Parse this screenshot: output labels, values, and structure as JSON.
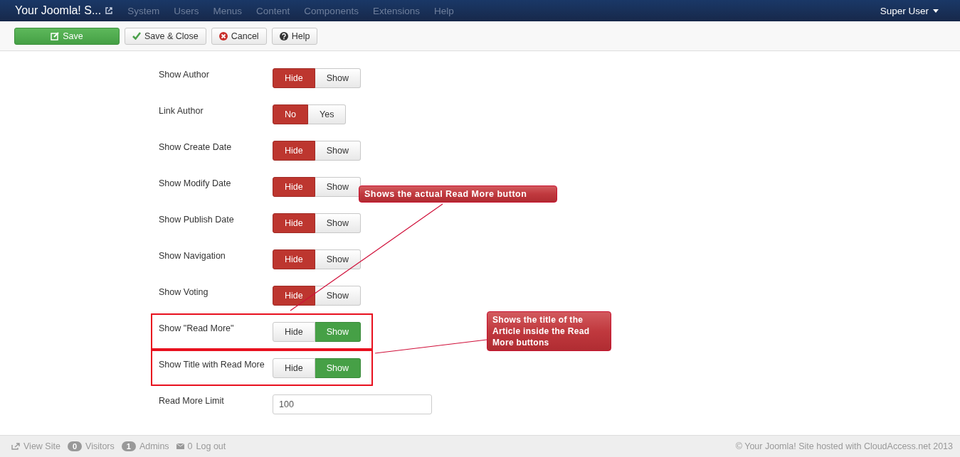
{
  "navbar": {
    "site_title": "Your Joomla! S...",
    "menu": [
      "System",
      "Users",
      "Menus",
      "Content",
      "Components",
      "Extensions",
      "Help"
    ],
    "user": "Super User"
  },
  "toolbar": [
    {
      "label": "Save",
      "kind": "primary"
    },
    {
      "label": "Save & Close",
      "kind": "check"
    },
    {
      "label": "Cancel",
      "kind": "cancel"
    },
    {
      "label": "Help",
      "kind": "help"
    }
  ],
  "fields": [
    {
      "label": "Show Author",
      "kind": "toggle",
      "highlighted": false,
      "options": [
        {
          "label": "Hide",
          "selected": true
        },
        {
          "label": "Show",
          "selected": false
        }
      ]
    },
    {
      "label": "Link Author",
      "kind": "toggle",
      "highlighted": false,
      "options": [
        {
          "label": "No",
          "selected": true
        },
        {
          "label": "Yes",
          "selected": false
        }
      ]
    },
    {
      "label": "Show Create Date",
      "kind": "toggle",
      "highlighted": false,
      "options": [
        {
          "label": "Hide",
          "selected": true
        },
        {
          "label": "Show",
          "selected": false
        }
      ]
    },
    {
      "label": "Show Modify Date",
      "kind": "toggle",
      "highlighted": false,
      "options": [
        {
          "label": "Hide",
          "selected": true
        },
        {
          "label": "Show",
          "selected": false
        }
      ]
    },
    {
      "label": "Show Publish Date",
      "kind": "toggle",
      "highlighted": false,
      "options": [
        {
          "label": "Hide",
          "selected": true
        },
        {
          "label": "Show",
          "selected": false
        }
      ]
    },
    {
      "label": "Show Navigation",
      "kind": "toggle",
      "highlighted": false,
      "options": [
        {
          "label": "Hide",
          "selected": true
        },
        {
          "label": "Show",
          "selected": false
        }
      ]
    },
    {
      "label": "Show Voting",
      "kind": "toggle",
      "highlighted": false,
      "options": [
        {
          "label": "Hide",
          "selected": true
        },
        {
          "label": "Show",
          "selected": false
        }
      ]
    },
    {
      "label": "Show \"Read More\"",
      "kind": "toggle",
      "highlighted": true,
      "options": [
        {
          "label": "Hide",
          "selected": false
        },
        {
          "label": "Show",
          "selected": true
        }
      ]
    },
    {
      "label": "Show Title with Read More",
      "kind": "toggle",
      "highlighted": true,
      "options": [
        {
          "label": "Hide",
          "selected": false
        },
        {
          "label": "Show",
          "selected": true
        }
      ]
    },
    {
      "label": "Read More Limit",
      "kind": "text",
      "highlighted": false,
      "value": "100"
    }
  ],
  "callouts": [
    "Shows the actual Read More button",
    "Shows the title of the Article inside the Read More buttons"
  ],
  "status_bar": {
    "view_site": "View Site",
    "visitors_count": "0",
    "visitors": "Visitors",
    "admins_count": "1",
    "admins": "Admins",
    "messages_count": "0",
    "logout": "Log out",
    "copyright": "© Your Joomla! Site hosted with CloudAccess.net 2013"
  }
}
